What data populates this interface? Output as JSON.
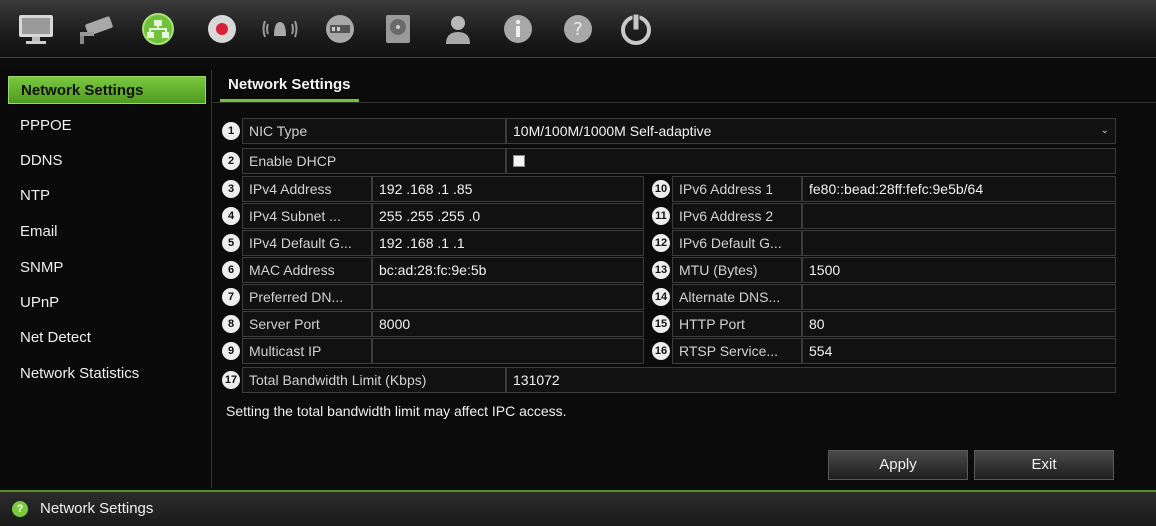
{
  "toolbar": {
    "icons": [
      "monitor-icon",
      "camera-icon",
      "network-icon",
      "record-icon",
      "alarm-icon",
      "device-icon",
      "hdd-icon",
      "user-icon",
      "info-icon",
      "help-icon",
      "power-icon"
    ]
  },
  "sidebar": {
    "items": [
      {
        "label": "Network Settings",
        "active": true
      },
      {
        "label": "PPPOE"
      },
      {
        "label": "DDNS"
      },
      {
        "label": "NTP"
      },
      {
        "label": "Email"
      },
      {
        "label": "SNMP"
      },
      {
        "label": "UPnP"
      },
      {
        "label": "Net Detect"
      },
      {
        "label": "Network Statistics"
      }
    ]
  },
  "main": {
    "tab": "Network Settings",
    "nic_type": {
      "num": "1",
      "label": "NIC Type",
      "value": "10M/100M/1000M Self-adaptive"
    },
    "enable_dhcp": {
      "num": "2",
      "label": "Enable DHCP",
      "checked": true
    },
    "left_fields": [
      {
        "num": "3",
        "label": "IPv4 Address",
        "value": "192 .168 .1    .85"
      },
      {
        "num": "4",
        "label": "IPv4 Subnet ...",
        "value": "255 .255 .255 .0"
      },
      {
        "num": "5",
        "label": "IPv4 Default G...",
        "value": "192 .168 .1    .1"
      },
      {
        "num": "6",
        "label": "MAC Address",
        "value": "bc:ad:28:fc:9e:5b"
      },
      {
        "num": "7",
        "label": "Preferred DN...",
        "value": ""
      },
      {
        "num": "8",
        "label": "Server Port",
        "value": "8000"
      },
      {
        "num": "9",
        "label": "Multicast IP",
        "value": ""
      }
    ],
    "right_fields": [
      {
        "num": "10",
        "label": "IPv6 Address 1",
        "value": "fe80::bead:28ff:fefc:9e5b/64"
      },
      {
        "num": "11",
        "label": "IPv6 Address 2",
        "value": ""
      },
      {
        "num": "12",
        "label": "IPv6 Default G...",
        "value": ""
      },
      {
        "num": "13",
        "label": "MTU (Bytes)",
        "value": "1500"
      },
      {
        "num": "14",
        "label": "Alternate DNS...",
        "value": ""
      },
      {
        "num": "15",
        "label": "HTTP Port",
        "value": "80"
      },
      {
        "num": "16",
        "label": "RTSP Service...",
        "value": "554"
      }
    ],
    "bandwidth": {
      "num": "17",
      "label": "Total Bandwidth Limit (Kbps)",
      "value": "131072"
    },
    "note": "Setting the total bandwidth limit may affect IPC access.",
    "apply_label": "Apply",
    "exit_label": "Exit"
  },
  "status": {
    "text": "Network Settings"
  }
}
